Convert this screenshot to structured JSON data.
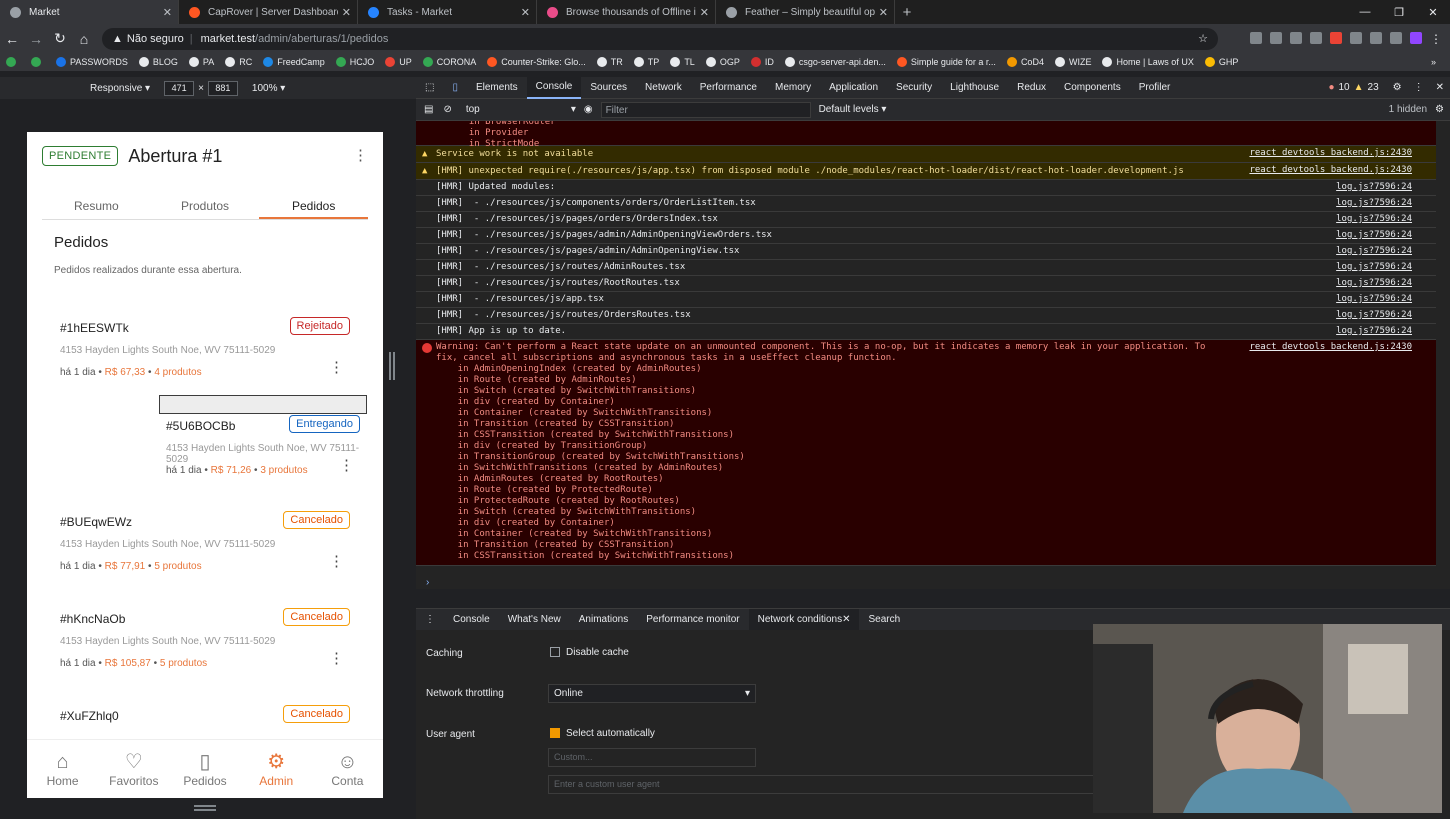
{
  "browser": {
    "tabs": [
      {
        "title": "Market",
        "favicon": "globe-icon",
        "color": "#9aa0a6",
        "active": true
      },
      {
        "title": "CapRover | Server Dashboard",
        "favicon": "caprover-icon",
        "color": "#ff5722",
        "active": false
      },
      {
        "title": "Tasks - Market",
        "favicon": "jira-icon",
        "color": "#2684ff",
        "active": false
      },
      {
        "title": "Browse thousands of Offline ima",
        "favicon": "dribbble-icon",
        "color": "#ea4c89",
        "active": false
      },
      {
        "title": "Feather – Simply beautiful open",
        "favicon": "feather-icon",
        "color": "#9aa0a6",
        "active": false
      }
    ],
    "new_tab": "+",
    "address": {
      "security": "Não seguro",
      "host": "market.test",
      "path": "/admin/aberturas/1/pedidos"
    },
    "bookmarks": [
      {
        "label": "",
        "color": "#34a853"
      },
      {
        "label": "",
        "color": "#34a853"
      },
      {
        "label": "PASSWORDS",
        "color": "#1a73e8"
      },
      {
        "label": "BLOG",
        "color": "#e8eaed"
      },
      {
        "label": "PA",
        "color": "#e8eaed"
      },
      {
        "label": "RC",
        "color": "#e8eaed"
      },
      {
        "label": "FreedCamp",
        "color": "#1e88e5"
      },
      {
        "label": "HCJO",
        "color": "#34a853"
      },
      {
        "label": "UP",
        "color": "#ea4335"
      },
      {
        "label": "CORONA",
        "color": "#34a853"
      },
      {
        "label": "Counter-Strike: Glo...",
        "color": "#ff5722"
      },
      {
        "label": "TR",
        "color": "#e8eaed"
      },
      {
        "label": "TP",
        "color": "#e8eaed"
      },
      {
        "label": "TL",
        "color": "#e8eaed"
      },
      {
        "label": "OGP",
        "color": "#e8eaed"
      },
      {
        "label": "ID",
        "color": "#d32f2f"
      },
      {
        "label": "csgo-server-api.den...",
        "color": "#e8eaed"
      },
      {
        "label": "Simple guide for a r...",
        "color": "#ff5722"
      },
      {
        "label": "CoD4",
        "color": "#f29900"
      },
      {
        "label": "WIZE",
        "color": "#e8eaed"
      },
      {
        "label": "Home | Laws of UX",
        "color": "#e8eaed"
      },
      {
        "label": "GHP",
        "color": "#fbbc04"
      }
    ],
    "more_bookmarks": "»"
  },
  "device_toolbar": {
    "mode": "Responsive",
    "width": "471",
    "times": "×",
    "height": "881",
    "zoom": "100%"
  },
  "app": {
    "status_badge": "PENDENTE",
    "title": "Abertura #1",
    "tabs": [
      {
        "label": "Resumo",
        "active": false
      },
      {
        "label": "Produtos",
        "active": false
      },
      {
        "label": "Pedidos",
        "active": true
      }
    ],
    "section_title": "Pedidos",
    "section_subtitle": "Pedidos realizados durante essa abertura.",
    "orders": [
      {
        "id": "#1hEESWTk",
        "status": "Rejeitado",
        "status_kind": "red",
        "address": "4153 Hayden Lights South Noe, WV 75111-5029",
        "time": "há 1 dia",
        "price": "R$ 67,33",
        "products": "4 produtos",
        "selected": false
      },
      {
        "id": "#5U6BOCBb",
        "status": "Entregando",
        "status_kind": "blue",
        "address": "4153 Hayden Lights South Noe, WV 75111-5029",
        "time": "há 1 dia",
        "price": "R$ 71,26",
        "products": "3 produtos",
        "selected": true
      },
      {
        "id": "#BUEqwEWz",
        "status": "Cancelado",
        "status_kind": "orange",
        "address": "4153 Hayden Lights South Noe, WV 75111-5029",
        "time": "há 1 dia",
        "price": "R$ 77,91",
        "products": "5 produtos",
        "selected": false
      },
      {
        "id": "#hKncNaOb",
        "status": "Cancelado",
        "status_kind": "orange",
        "address": "4153 Hayden Lights South Noe, WV 75111-5029",
        "time": "há 1 dia",
        "price": "R$ 105,87",
        "products": "5 produtos",
        "selected": false
      },
      {
        "id": "#XuFZhlq0",
        "status": "Cancelado",
        "status_kind": "orange",
        "address": "",
        "time": "",
        "price": "",
        "products": "",
        "selected": false
      }
    ],
    "bottom_nav": [
      {
        "label": "Home",
        "icon": "home-icon",
        "glyph": "⌂",
        "active": false
      },
      {
        "label": "Favoritos",
        "icon": "heart-icon",
        "glyph": "♡",
        "active": false
      },
      {
        "label": "Pedidos",
        "icon": "book-icon",
        "glyph": "▯",
        "active": false
      },
      {
        "label": "Admin",
        "icon": "gear-icon",
        "glyph": "⚙",
        "active": true
      },
      {
        "label": "Conta",
        "icon": "user-icon",
        "glyph": "☺",
        "active": false
      }
    ]
  },
  "devtools": {
    "tabs": [
      "Elements",
      "Console",
      "Sources",
      "Network",
      "Performance",
      "Memory",
      "Application",
      "Security",
      "Lighthouse",
      "Redux",
      "Components",
      "Profiler"
    ],
    "active_tab": "Console",
    "error_count": "10",
    "warning_count": "23",
    "context": "top",
    "filter_placeholder": "Filter",
    "levels": "Default levels",
    "hidden": "1 hidden",
    "console": {
      "top_error_tail": [
        "  in BrowserRouter",
        "  in Provider",
        "  in StrictMode"
      ],
      "warnings": [
        {
          "text": "Service work is not available",
          "source": "react_devtools_backend.js:2430"
        },
        {
          "text": "[HMR] unexpected require(./resources/js/app.tsx) from disposed module ./node_modules/react-hot-loader/dist/react-hot-loader.development.js",
          "source": "react_devtools_backend.js:2430"
        }
      ],
      "logs": [
        {
          "text": "[HMR] Updated modules:",
          "source": "log.js?7596:24"
        },
        {
          "text": "[HMR]  - ./resources/js/components/orders/OrderListItem.tsx",
          "source": "log.js?7596:24"
        },
        {
          "text": "[HMR]  - ./resources/js/pages/orders/OrdersIndex.tsx",
          "source": "log.js?7596:24"
        },
        {
          "text": "[HMR]  - ./resources/js/pages/admin/AdminOpeningViewOrders.tsx",
          "source": "log.js?7596:24"
        },
        {
          "text": "[HMR]  - ./resources/js/pages/admin/AdminOpeningView.tsx",
          "source": "log.js?7596:24"
        },
        {
          "text": "[HMR]  - ./resources/js/routes/AdminRoutes.tsx",
          "source": "log.js?7596:24"
        },
        {
          "text": "[HMR]  - ./resources/js/routes/RootRoutes.tsx",
          "source": "log.js?7596:24"
        },
        {
          "text": "[HMR]  - ./resources/js/app.tsx",
          "source": "log.js?7596:24"
        },
        {
          "text": "[HMR]  - ./resources/js/routes/OrdersRoutes.tsx",
          "source": "log.js?7596:24"
        },
        {
          "text": "[HMR] App is up to date.",
          "source": "log.js?7596:24"
        }
      ],
      "error": {
        "message": "Warning: Can't perform a React state update on an unmounted component. This is a no-op, but it indicates a memory leak in your application. To\nfix, cancel all subscriptions and asynchronous tasks in a useEffect cleanup function.",
        "source": "react_devtools_backend.js:2430",
        "stack": [
          "    in AdminOpeningIndex (created by AdminRoutes)",
          "    in Route (created by AdminRoutes)",
          "    in Switch (created by SwitchWithTransitions)",
          "    in div (created by Container)",
          "    in Container (created by SwitchWithTransitions)",
          "    in Transition (created by CSSTransition)",
          "    in CSSTransition (created by SwitchWithTransitions)",
          "    in div (created by TransitionGroup)",
          "    in TransitionGroup (created by SwitchWithTransitions)",
          "    in SwitchWithTransitions (created by AdminRoutes)",
          "    in AdminRoutes (created by RootRoutes)",
          "    in Route (created by ProtectedRoute)",
          "    in ProtectedRoute (created by RootRoutes)",
          "    in Switch (created by SwitchWithTransitions)",
          "    in div (created by Container)",
          "    in Container (created by SwitchWithTransitions)",
          "    in Transition (created by CSSTransition)",
          "    in CSSTransition (created by SwitchWithTransitions)"
        ]
      }
    },
    "drawer": {
      "tabs": [
        "Console",
        "What's New",
        "Animations",
        "Performance monitor",
        "Network conditions",
        "Search"
      ],
      "active_tab": "Network conditions",
      "caching_label": "Caching",
      "disable_cache_label": "Disable cache",
      "throttling_label": "Network throttling",
      "throttling_value": "Online",
      "user_agent_label": "User agent",
      "select_auto_label": "Select automatically",
      "custom_placeholder": "Custom...",
      "custom_ua_placeholder": "Enter a custom user agent"
    }
  }
}
